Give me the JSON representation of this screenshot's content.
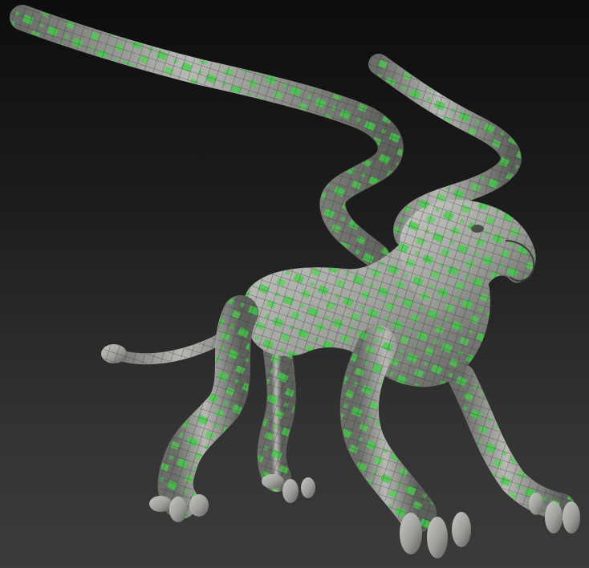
{
  "scene": {
    "subject": "griffin-sculpt",
    "palette": {
      "background_top": "#0d0d0d",
      "background_bottom": "#3b3b3b",
      "surface": "#a9aaa6",
      "surface_shadow": "#4f524e",
      "wire": "#2d2f2c",
      "mask_green": "#3fcf45"
    }
  }
}
